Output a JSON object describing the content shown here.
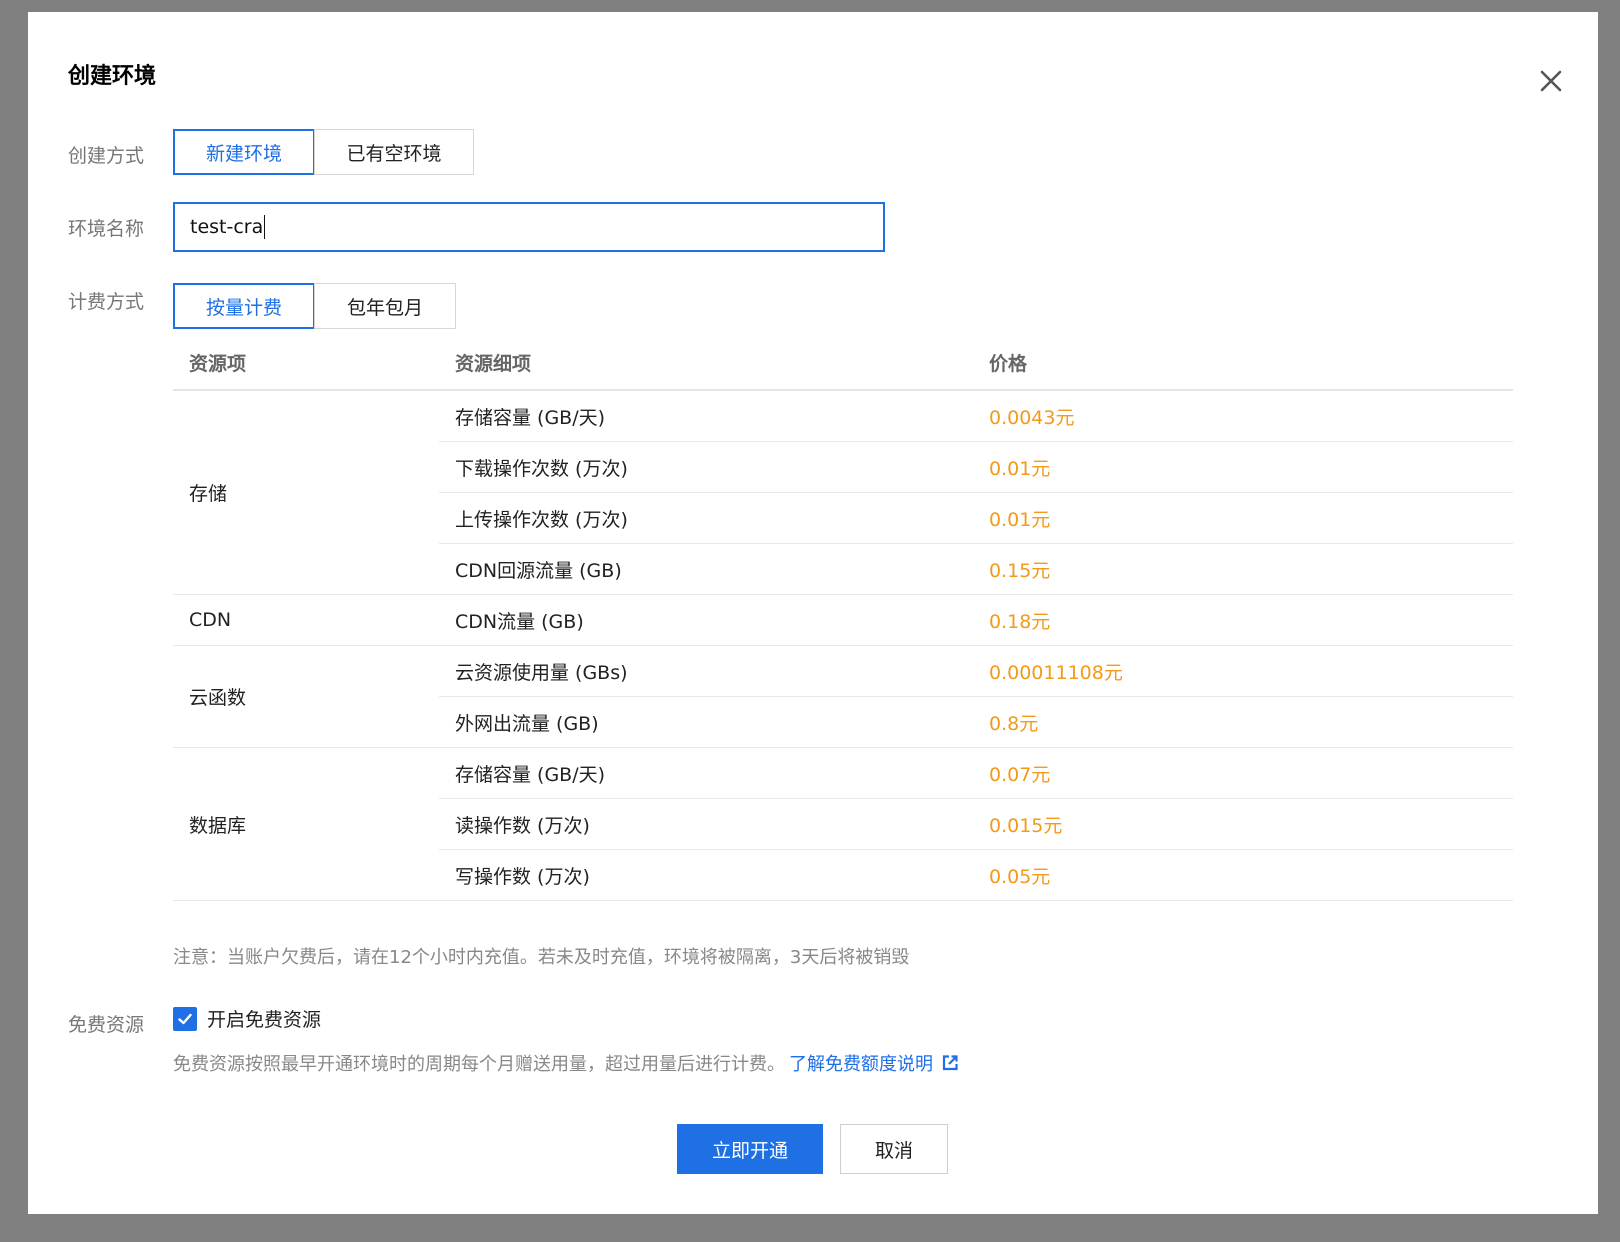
{
  "dialog": {
    "title": "创建环境",
    "close_icon": "close-icon"
  },
  "form": {
    "create_method": {
      "label": "创建方式",
      "options": [
        "新建环境",
        "已有空环境"
      ],
      "selected": "新建环境"
    },
    "env_name": {
      "label": "环境名称",
      "value": "test-cra"
    },
    "billing": {
      "label": "计费方式",
      "options": [
        "按量计费",
        "包年包月"
      ],
      "selected": "按量计费"
    }
  },
  "price_table": {
    "headers": [
      "资源项",
      "资源细项",
      "价格"
    ],
    "groups": [
      {
        "name": "存储",
        "rows": [
          {
            "item": "存储容量 (GB/天)",
            "price": "0.0043元"
          },
          {
            "item": "下载操作次数 (万次)",
            "price": "0.01元"
          },
          {
            "item": "上传操作次数 (万次)",
            "price": "0.01元"
          },
          {
            "item": "CDN回源流量 (GB)",
            "price": "0.15元"
          }
        ]
      },
      {
        "name": "CDN",
        "rows": [
          {
            "item": "CDN流量 (GB)",
            "price": "0.18元"
          }
        ]
      },
      {
        "name": "云函数",
        "rows": [
          {
            "item": "云资源使用量 (GBs)",
            "price": "0.00011108元"
          },
          {
            "item": "外网出流量 (GB)",
            "price": "0.8元"
          }
        ]
      },
      {
        "name": "数据库",
        "rows": [
          {
            "item": "存储容量 (GB/天)",
            "price": "0.07元"
          },
          {
            "item": "读操作数 (万次)",
            "price": "0.015元"
          },
          {
            "item": "写操作数 (万次)",
            "price": "0.05元"
          }
        ]
      }
    ]
  },
  "note": "注意：当账户欠费后，请在12个小时内充值。若未及时充值，环境将被隔离，3天后将被销毁",
  "free_resource": {
    "label": "免费资源",
    "checkbox_label": "开启免费资源",
    "checked": true,
    "description": "免费资源按照最早开通环境时的周期每个月赠送用量，超过用量后进行计费。",
    "link_text": "了解免费额度说明"
  },
  "actions": {
    "confirm": "立即开通",
    "cancel": "取消"
  },
  "colors": {
    "accent": "#1f6fe5",
    "price": "#f39a1a"
  }
}
